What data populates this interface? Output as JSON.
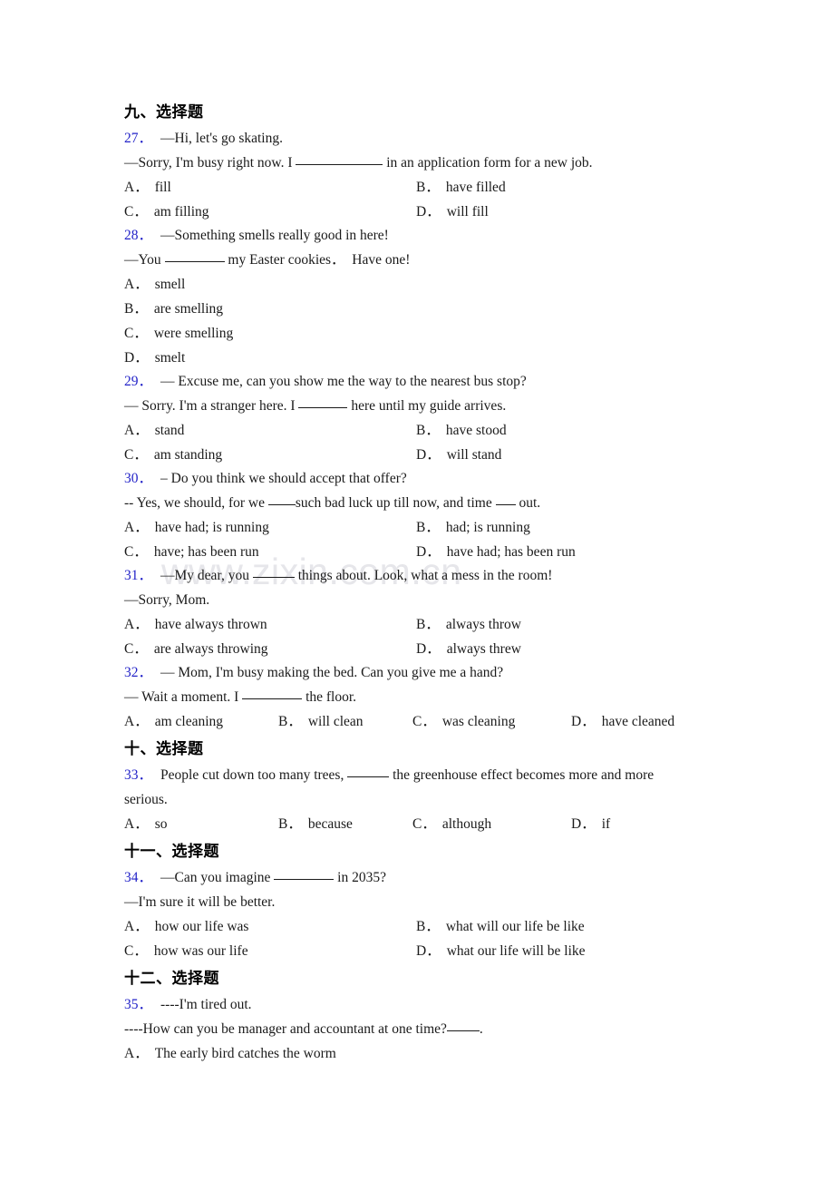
{
  "watermark": {
    "text": "www.zixin.com.cn"
  },
  "colors": {
    "question_number": "#2323c8",
    "body_text": "#1a1a1a",
    "watermark": "#e6e6ea"
  },
  "sections": [
    {
      "heading": "九、选择题",
      "questions": [
        {
          "number": "27．",
          "stem_lines": [
            "—Hi, let's go skating.",
            "—Sorry, I'm busy right now. I ",
            " in an application form for a new job."
          ],
          "layout": "cols2",
          "options": [
            {
              "label": "A．",
              "text": "fill"
            },
            {
              "label": "B．",
              "text": "have filled"
            },
            {
              "label": "C．",
              "text": "am filling"
            },
            {
              "label": "D．",
              "text": "will fill"
            }
          ]
        },
        {
          "number": "28．",
          "stem_lines": [
            "—Something smells really good in here!",
            "—You ",
            " my Easter cookies．  Have one!"
          ],
          "layout": "cols1",
          "options": [
            {
              "label": "A．",
              "text": "smell"
            },
            {
              "label": "B．",
              "text": "are smelling"
            },
            {
              "label": "C．",
              "text": "were smelling"
            },
            {
              "label": "D．",
              "text": "smelt"
            }
          ]
        },
        {
          "number": "29．",
          "stem_lines": [
            "— Excuse me, can you show me the way to the nearest bus stop?",
            "— Sorry. I'm a stranger here. I ",
            " here until my guide arrives."
          ],
          "layout": "cols2",
          "options": [
            {
              "label": "A．",
              "text": "stand"
            },
            {
              "label": "B．",
              "text": "have stood"
            },
            {
              "label": "C．",
              "text": "am standing"
            },
            {
              "label": "D．",
              "text": "will stand"
            }
          ]
        },
        {
          "number": "30．",
          "stem_lines": [
            "– Do you think we should accept that offer?",
            "-- Yes, we should, for we ",
            "such bad luck up till now, and time ",
            " out."
          ],
          "layout": "cols2",
          "options": [
            {
              "label": "A．",
              "text": "have had; is running"
            },
            {
              "label": "B．",
              "text": "had; is running"
            },
            {
              "label": "C．",
              "text": "have; has been run"
            },
            {
              "label": "D．",
              "text": "have had; has been run"
            }
          ]
        },
        {
          "number": "31．",
          "stem_lines": [
            "—My dear, you ",
            " things about. Look, what a mess in the room!",
            "—Sorry, Mom."
          ],
          "layout": "cols2",
          "options": [
            {
              "label": "A．",
              "text": "have always thrown"
            },
            {
              "label": "B．",
              "text": "always throw"
            },
            {
              "label": "C．",
              "text": "are always throwing"
            },
            {
              "label": "D．",
              "text": "always threw"
            }
          ]
        },
        {
          "number": "32．",
          "stem_lines": [
            "— Mom, I'm busy making the bed. Can you give me a hand?",
            "— Wait a moment. I ",
            " the floor."
          ],
          "layout": "cols4",
          "options": [
            {
              "label": "A．",
              "text": "am cleaning"
            },
            {
              "label": "B．",
              "text": "will clean"
            },
            {
              "label": "C．",
              "text": "was cleaning"
            },
            {
              "label": "D．",
              "text": "have cleaned"
            }
          ]
        }
      ]
    },
    {
      "heading": "十、选择题",
      "questions": [
        {
          "number": "33．",
          "stem_lines": [
            "People cut down too many trees, ",
            " the greenhouse effect becomes more and more",
            "serious."
          ],
          "layout": "cols4b",
          "options": [
            {
              "label": "A．",
              "text": "so"
            },
            {
              "label": "B．",
              "text": "because"
            },
            {
              "label": "C．",
              "text": "although"
            },
            {
              "label": "D．",
              "text": "if"
            }
          ]
        }
      ]
    },
    {
      "heading": "十一、选择题",
      "questions": [
        {
          "number": "34．",
          "stem_lines": [
            "—Can you imagine ",
            " in 2035?",
            "—I'm sure it will be better."
          ],
          "layout": "cols2",
          "options": [
            {
              "label": "A．",
              "text": "how our life was"
            },
            {
              "label": "B．",
              "text": "what will our life be like"
            },
            {
              "label": "C．",
              "text": "how was our life"
            },
            {
              "label": "D．",
              "text": "what our life will be like"
            }
          ]
        }
      ]
    },
    {
      "heading": "十二、选择题",
      "questions": [
        {
          "number": "35．",
          "stem_lines": [
            "----I'm tired out.",
            "----How can you be manager and accountant at one time?",
            "."
          ],
          "layout": "cols1",
          "options": [
            {
              "label": "A．",
              "text": "The early bird catches the worm"
            }
          ]
        }
      ]
    }
  ],
  "q27": {
    "num": "27．",
    "l1": "—Hi, let's go skating.",
    "l2a": "—Sorry, I'm busy right now. I",
    "l2b": "in an application form for a new job.",
    "oA": "A．",
    "oAt": "fill",
    "oB": "B．",
    "oBt": "have filled",
    "oC": "C．",
    "oCt": "am filling",
    "oD": "D．",
    "oDt": "will fill"
  },
  "q28": {
    "num": "28．",
    "l1": "—Something smells really good in here!",
    "l2a": "—You",
    "l2b": "my Easter cookies．  Have one!",
    "oA": "A．",
    "oAt": "smell",
    "oB": "B．",
    "oBt": "are smelling",
    "oC": "C．",
    "oCt": "were smelling",
    "oD": "D．",
    "oDt": "smelt"
  },
  "q29": {
    "num": "29．",
    "l1": "— Excuse me, can you show me the way to the nearest bus stop?",
    "l2a": "— Sorry. I'm a stranger here. I",
    "l2b": "here until my guide arrives.",
    "oA": "A．",
    "oAt": "stand",
    "oB": "B．",
    "oBt": "have stood",
    "oC": "C．",
    "oCt": "am standing",
    "oD": "D．",
    "oDt": "will stand"
  },
  "q30": {
    "num": "30．",
    "l1": "– Do you think we should accept that offer?",
    "l2a": "-- Yes, we should, for we",
    "l2b": "such bad luck up till now, and time",
    "l2c": "out.",
    "oA": "A．",
    "oAt": "have had; is running",
    "oB": "B．",
    "oBt": "had; is running",
    "oC": "C．",
    "oCt": "have; has been run",
    "oD": "D．",
    "oDt": "have had; has been run"
  },
  "q31": {
    "num": "31．",
    "l1a": "—My dear, you",
    "l1b": "things about. Look, what a mess in the room!",
    "l2": "—Sorry, Mom.",
    "oA": "A．",
    "oAt": "have always thrown",
    "oB": "B．",
    "oBt": "always throw",
    "oC": "C．",
    "oCt": "are always throwing",
    "oD": "D．",
    "oDt": "always threw"
  },
  "q32": {
    "num": "32．",
    "l1": "— Mom, I'm busy making the bed. Can you give me a hand?",
    "l2a": "— Wait a moment. I",
    "l2b": "the floor.",
    "oA": "A．",
    "oAt": "am cleaning",
    "oB": "B．",
    "oBt": "will clean",
    "oC": "C．",
    "oCt": "was cleaning",
    "oD": "D．",
    "oDt": "have cleaned"
  },
  "q33": {
    "num": "33．",
    "l1a": "People cut down too many trees,",
    "l1b": "the greenhouse effect becomes more and more",
    "l2": "serious.",
    "oA": "A．",
    "oAt": "so",
    "oB": "B．",
    "oBt": "because",
    "oC": "C．",
    "oCt": "although",
    "oD": "D．",
    "oDt": "if"
  },
  "q34": {
    "num": "34．",
    "l1a": "—Can you imagine",
    "l1b": "in 2035?",
    "l2": "—I'm sure it will be better.",
    "oA": "A．",
    "oAt": "how our life was",
    "oB": "B．",
    "oBt": "what will our life be like",
    "oC": "C．",
    "oCt": "how was our life",
    "oD": "D．",
    "oDt": "what our life will be like"
  },
  "q35": {
    "num": "35．",
    "l1": "----I'm tired out.",
    "l2a": "----How can you be manager and accountant at one time?",
    "l2b": ".",
    "oA": "A．",
    "oAt": "The early bird catches the worm"
  },
  "headings": {
    "s9": "九、选择题",
    "s10": "十、选择题",
    "s11": "十一、选择题",
    "s12": "十二、选择题"
  }
}
